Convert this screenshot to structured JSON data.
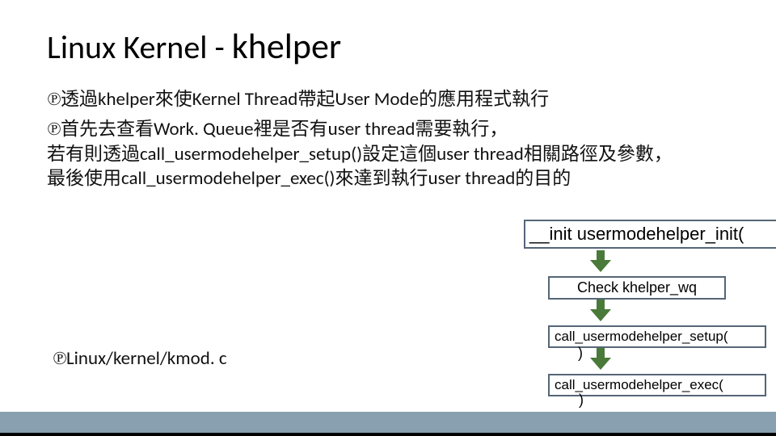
{
  "title_pre": "Linux Kernel - ",
  "title_kw": "khelper",
  "bullet1": "透過khelper來使Kernel Thread帶起User Mode的應用程式執行",
  "bullet2_l1": "首先去查看Work. Queue裡是否有user thread需要執行，",
  "bullet2_l2": "若有則透過call_usermodehelper_setup()設定這個user thread相關路徑及參數，",
  "bullet2_l3": "最後使用call_usermodehelper_exec()來達到執行user thread的目的",
  "source": "Linux/kernel/kmod. c",
  "flow": {
    "init": "__init usermodehelper_init(",
    "check": "Check khelper_wq",
    "setup": "call_usermodehelper_setup(",
    "exec": "call_usermodehelper_exec("
  },
  "paren": ")",
  "link_glyph": "℗",
  "arrow_fill": "#4a7a3a"
}
